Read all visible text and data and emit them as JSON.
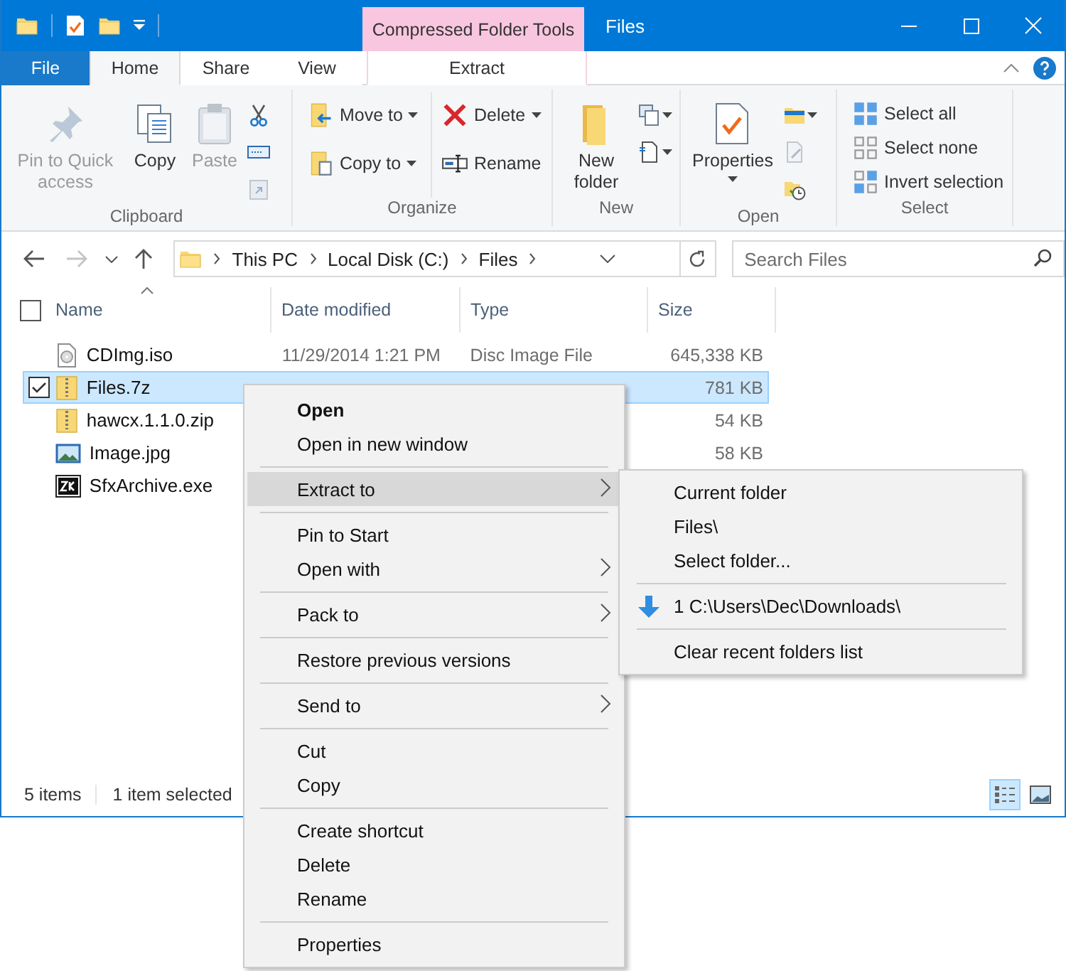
{
  "title_bar": {
    "contextual_group": "Compressed Folder Tools",
    "title": "Files"
  },
  "ribbon_tabs": [
    {
      "label": "File",
      "kind": "file",
      "selected": false
    },
    {
      "label": "Home",
      "kind": "normal",
      "selected": true
    },
    {
      "label": "Share",
      "kind": "normal",
      "selected": false
    },
    {
      "label": "View",
      "kind": "normal",
      "selected": false
    },
    {
      "label": "Extract",
      "kind": "contextual",
      "selected": false
    }
  ],
  "ribbon_groups": [
    {
      "label": "Clipboard",
      "columns": [
        [
          {
            "kind": "large",
            "label": "Pin to Quick access",
            "disabled": true,
            "dropdown": false
          }
        ],
        [
          {
            "kind": "large",
            "label": "Copy",
            "disabled": false,
            "dropdown": false
          }
        ],
        [
          {
            "kind": "large",
            "label": "Paste",
            "disabled": true,
            "dropdown": false
          }
        ],
        [
          {
            "kind": "small",
            "disabled": false,
            "dropdown": false
          },
          {
            "kind": "small",
            "disabled": false,
            "dropdown": false
          },
          {
            "kind": "small",
            "disabled": true,
            "dropdown": false
          }
        ]
      ]
    },
    {
      "label": "Organize",
      "columns": [
        [
          {
            "kind": "small",
            "label": "Move to",
            "disabled": false,
            "dropdown": true
          },
          {
            "kind": "small",
            "label": "Copy to",
            "disabled": false,
            "dropdown": true
          }
        ],
        [
          {
            "kind": "small",
            "label": "Delete",
            "disabled": false,
            "dropdown": true
          },
          {
            "kind": "small",
            "label": "Rename",
            "disabled": false,
            "dropdown": false
          }
        ]
      ]
    },
    {
      "label": "New",
      "columns": [
        [
          {
            "kind": "large",
            "label": "New folder",
            "disabled": false,
            "dropdown": false
          }
        ],
        [
          {
            "kind": "small",
            "disabled": false,
            "dropdown": true
          },
          {
            "kind": "small",
            "disabled": false,
            "dropdown": true
          }
        ]
      ]
    },
    {
      "label": "Open",
      "columns": [
        [
          {
            "kind": "large",
            "label": "Properties",
            "disabled": false,
            "dropdown": true
          }
        ],
        [
          {
            "kind": "small",
            "disabled": false,
            "dropdown": true
          },
          {
            "kind": "small",
            "disabled": true,
            "dropdown": false
          },
          {
            "kind": "small",
            "disabled": false,
            "dropdown": false
          }
        ]
      ]
    },
    {
      "label": "Select",
      "columns": [
        [
          {
            "kind": "small",
            "label": "Select all",
            "disabled": false,
            "dropdown": false
          },
          {
            "kind": "small",
            "label": "Select none",
            "disabled": false,
            "dropdown": false
          },
          {
            "kind": "small",
            "label": "Invert selection",
            "disabled": false,
            "dropdown": false
          }
        ]
      ]
    }
  ],
  "nav_buttons": [
    {
      "kind": "back",
      "disabled": false
    },
    {
      "kind": "forward",
      "disabled": true
    },
    {
      "kind": "recent",
      "disabled": false
    },
    {
      "kind": "up",
      "disabled": false
    }
  ],
  "address": {
    "path": [
      "This PC",
      "Local Disk (C:)",
      "Files"
    ]
  },
  "search": {
    "placeholder": "Search Files"
  },
  "table": {
    "header_checkbox": {
      "checked": false
    },
    "columns": [
      {
        "label": "Name",
        "sorted": true
      },
      {
        "label": "Date modified",
        "sorted": false
      },
      {
        "label": "Type",
        "sorted": false
      },
      {
        "label": "Size",
        "sorted": false
      }
    ],
    "rows": [
      {
        "kind": "disc",
        "name": "CDImg.iso",
        "date": "11/29/2014 1:21 PM",
        "type": "Disc Image File",
        "size": "645,338 KB",
        "selected": false
      },
      {
        "kind": "archive",
        "name": "Files.7z",
        "size": "781 KB",
        "selected": true
      },
      {
        "kind": "archive",
        "name": "hawcx.1.1.0.zip",
        "size": "54 KB",
        "selected": false
      },
      {
        "kind": "image",
        "name": "Image.jpg",
        "size": "58 KB",
        "selected": false
      },
      {
        "kind": "sfx",
        "name": "SfxArchive.exe",
        "selected": false
      }
    ]
  },
  "status_bar": {
    "items": [
      "5 items",
      "1 item selected"
    ],
    "views": [
      {
        "kind": "details",
        "selected": true
      },
      {
        "kind": "large_icons",
        "selected": false
      }
    ]
  },
  "context_menu": {
    "groups": [
      [
        {
          "label": "Open",
          "default": true,
          "selected": false,
          "submenu": false
        },
        {
          "label": "Open in new window",
          "default": false,
          "selected": false,
          "submenu": false
        }
      ],
      [
        {
          "label": "Extract to",
          "default": false,
          "selected": true,
          "submenu": true
        }
      ],
      [
        {
          "label": "Pin to Start",
          "default": false,
          "selected": false,
          "submenu": false
        },
        {
          "label": "Open with",
          "default": false,
          "selected": false,
          "submenu": true
        }
      ],
      [
        {
          "label": "Pack to",
          "default": false,
          "selected": false,
          "submenu": true
        }
      ],
      [
        {
          "label": "Restore previous versions",
          "default": false,
          "selected": false,
          "submenu": false
        }
      ],
      [
        {
          "label": "Send to",
          "default": false,
          "selected": false,
          "submenu": true
        }
      ],
      [
        {
          "label": "Cut",
          "default": false,
          "selected": false,
          "submenu": false
        },
        {
          "label": "Copy",
          "default": false,
          "selected": false,
          "submenu": false
        }
      ],
      [
        {
          "label": "Create shortcut",
          "default": false,
          "selected": false,
          "submenu": false
        },
        {
          "label": "Delete",
          "default": false,
          "selected": false,
          "submenu": false
        },
        {
          "label": "Rename",
          "default": false,
          "selected": false,
          "submenu": false
        }
      ],
      [
        {
          "label": "Properties",
          "default": false,
          "selected": false,
          "submenu": false
        }
      ]
    ]
  },
  "submenu": {
    "groups": [
      [
        {
          "label": "Current folder",
          "kind": "plain"
        },
        {
          "label": "Files\\",
          "kind": "plain"
        },
        {
          "label": "Select folder...",
          "kind": "plain"
        }
      ],
      [
        {
          "label": "1 C:\\Users\\Dec\\Downloads\\",
          "kind": "recent"
        }
      ],
      [
        {
          "label": "Clear recent folders list",
          "kind": "plain"
        }
      ]
    ]
  }
}
